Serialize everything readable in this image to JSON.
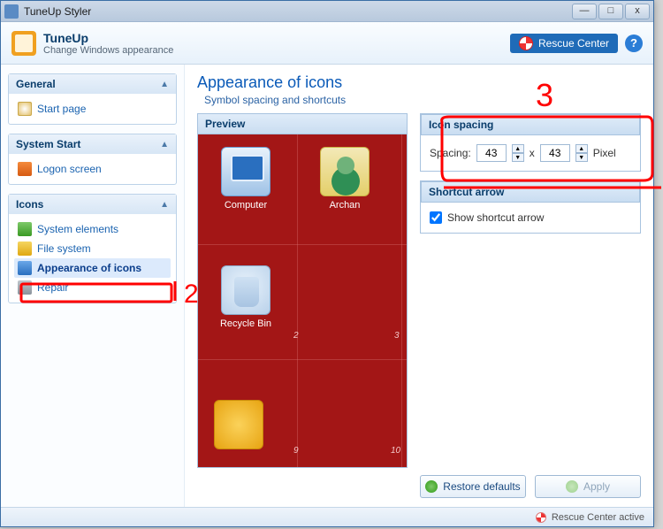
{
  "titlebar": {
    "title": "TuneUp Styler"
  },
  "header": {
    "title": "TuneUp",
    "subtitle": "Change Windows appearance",
    "rescue_label": "Rescue Center",
    "help_label": "?"
  },
  "sidebar": {
    "panels": [
      {
        "title": "General",
        "items": [
          {
            "label": "Start page",
            "icon": "ico-home"
          }
        ]
      },
      {
        "title": "System Start",
        "items": [
          {
            "label": "Logon screen",
            "icon": "ico-logon"
          }
        ]
      },
      {
        "title": "Icons",
        "items": [
          {
            "label": "System elements",
            "icon": "ico-sys"
          },
          {
            "label": "File system",
            "icon": "ico-fs"
          },
          {
            "label": "Appearance of icons",
            "icon": "ico-app",
            "selected": true
          },
          {
            "label": "Repair",
            "icon": "ico-rep"
          }
        ]
      }
    ]
  },
  "main": {
    "title": "Appearance of icons",
    "subtitle": "Symbol spacing and shortcuts",
    "preview_label": "Preview",
    "preview_icons": {
      "computer": "Computer",
      "user": "Archan",
      "bin": "Recycle Bin"
    },
    "icon_spacing": {
      "title": "Icon spacing",
      "label": "Spacing:",
      "h": "43",
      "x": "x",
      "v": "43",
      "unit": "Pixel"
    },
    "shortcut_arrow": {
      "title": "Shortcut arrow",
      "checkbox_label": "Show shortcut arrow",
      "checked": true
    },
    "buttons": {
      "restore": "Restore defaults",
      "apply": "Apply"
    }
  },
  "statusbar": {
    "text": "Rescue Center active"
  },
  "annotations": {
    "two": "2",
    "three": "3"
  }
}
